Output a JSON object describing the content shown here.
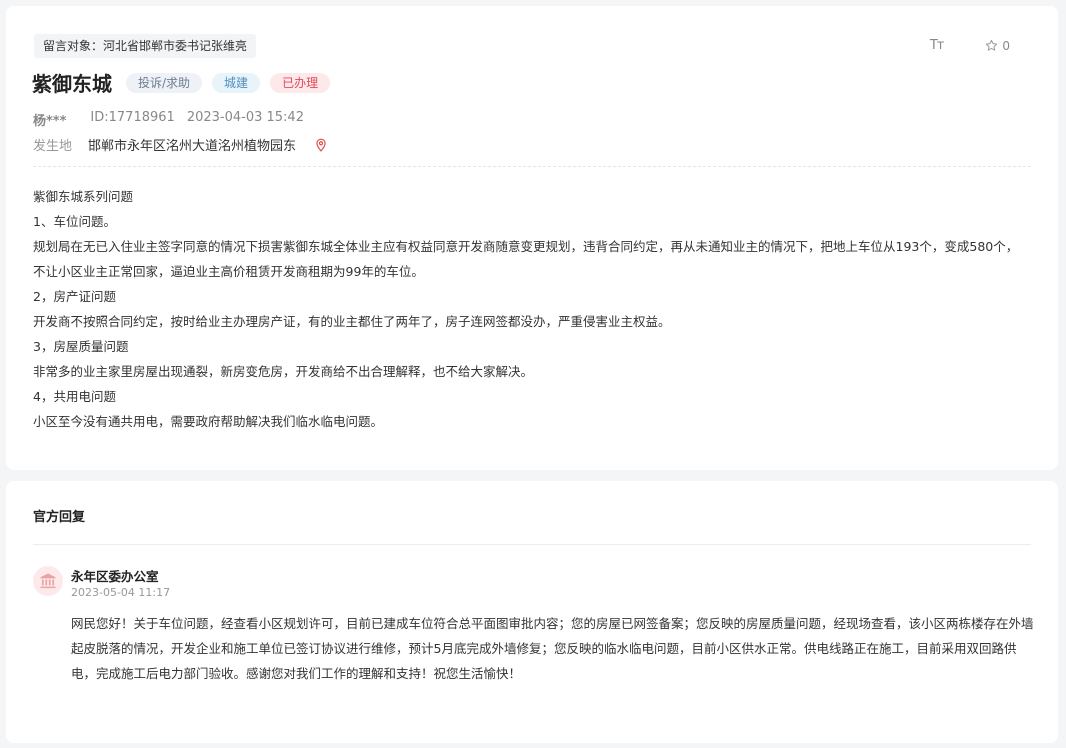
{
  "message": {
    "target": "留言对象：河北省邯郸市委书记张维亮",
    "toolbar": {
      "font_label": "Tт",
      "star_count": "0"
    },
    "title": "紫御东城",
    "badges": {
      "category": "投诉/求助",
      "subcategory": "城建",
      "status": "已办理"
    },
    "meta": {
      "user": "杨***",
      "id": "ID:17718961",
      "datetime": "2023-04-03 15:42"
    },
    "location": {
      "label": "发生地",
      "value": "邯郸市永年区洺州大道洺州植物园东"
    },
    "content": [
      "紫御东城系列问题",
      "1、车位问题。",
      "规划局在无已入住业主签字同意的情况下损害紫御东城全体业主应有权益同意开发商随意变更规划，违背合同约定，再从未通知业主的情况下，把地上车位从193个，变成580个，",
      "不让小区业主正常回家，逼迫业主高价租赁开发商租期为99年的车位。",
      "2，房产证问题",
      "开发商不按照合同约定，按时给业主办理房产证，有的业主都住了两年了，房子连网签都没办，严重侵害业主权益。",
      "3，房屋质量问题",
      "非常多的业主家里房屋出现通裂，新房变危房，开发商给不出合理解释，也不给大家解决。",
      "4，共用电问题",
      "小区至今没有通共用电，需要政府帮助解决我们临水临电问题。"
    ]
  },
  "reply": {
    "heading": "官方回复",
    "department": "永年区委办公室",
    "datetime": "2023-05-04 11:17",
    "text": "网民您好！关于车位问题，经查看小区规划许可，目前已建成车位符合总平面图审批内容；您的房屋已网签备案；您反映的房屋质量问题，经现场查看，该小区两栋楼存在外墙起皮脱落的情况，开发企业和施工单位已签订协议进行维修，预计5月底完成外墙修复；您反映的临水临电问题，目前小区供水正常。供电线路正在施工，目前采用双回路供电，完成施工后电力部门验收。感谢您对我们工作的理解和支持！祝您生活愉快！"
  },
  "colors": {
    "status_red": "#e0485a",
    "pin_red": "#e04646",
    "avatar_bg": "#fde9e9"
  }
}
